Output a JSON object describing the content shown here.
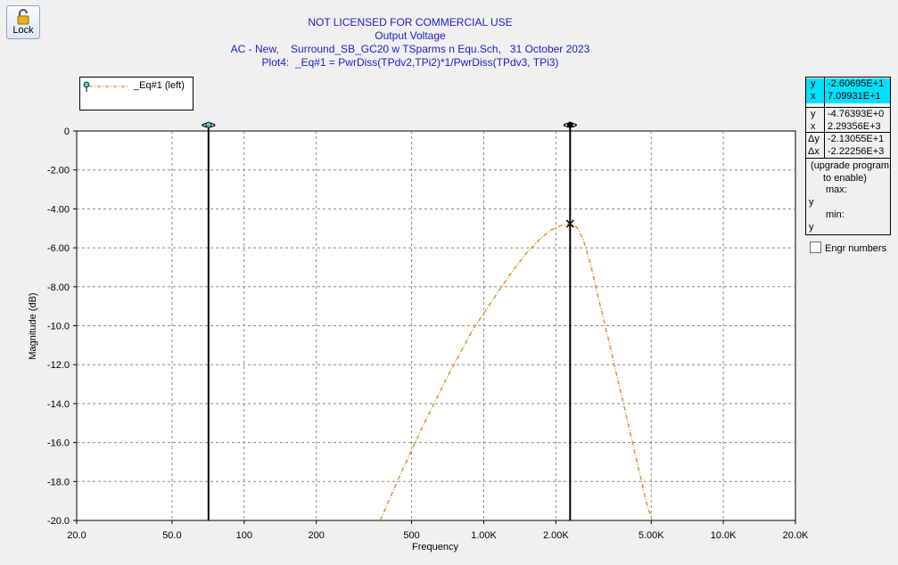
{
  "toolbar": {
    "lock_label": "Lock"
  },
  "header": {
    "license": "NOT LICENSED FOR COMMERCIAL USE",
    "title": "Output Voltage",
    "subtitle": "AC - New,    Surround_SB_GC20 w TSparms n Equ.Sch,   31 October 2023",
    "plot_label": "Plot4:  _Eq#1 = PwrDiss(TPdv2,TPi2)*1/PwrDiss(TPdv3, TPi3)"
  },
  "legend": {
    "label": "_Eq#1 (left)"
  },
  "readout": {
    "c1_y_key": "y",
    "c1_y": "-2.60695E+1",
    "c1_x_key": "x",
    "c1_x": "7.09931E+1",
    "c2_y_key": "y",
    "c2_y": "-4.76393E+0",
    "c2_x_key": "x",
    "c2_x": "2.29356E+3",
    "dy_key": "Δy",
    "dy": "-2.13055E+1",
    "dx_key": "Δx",
    "dx": "-2.22256E+3",
    "upgrade_line1": "(upgrade program",
    "upgrade_line2": "to enable)",
    "max_label": "max:",
    "min_label": "min:",
    "y_key_a": "y",
    "y_key_b": "y"
  },
  "engr_label": "Engr numbers",
  "chart_data": {
    "type": "line",
    "xlabel": "Frequency",
    "ylabel": "Magnitude  (dB)",
    "x_scale": "log",
    "xlim": [
      20,
      20000
    ],
    "ylim": [
      -20,
      0
    ],
    "grid": true,
    "legend_position": "top-left",
    "x_ticks": [
      20,
      50,
      100,
      200,
      500,
      1000,
      2000,
      5000,
      10000,
      20000
    ],
    "x_tick_labels": [
      "20.0",
      "50.0",
      "100",
      "200",
      "500",
      "1.00K",
      "2.00K",
      "5.00K",
      "10.0K",
      "20.0K"
    ],
    "y_ticks": [
      0,
      -2,
      -4,
      -6,
      -8,
      -10,
      -12,
      -14,
      -16,
      -18,
      -20
    ],
    "y_tick_labels": [
      "0",
      "-2.00",
      "-4.00",
      "-6.00",
      "-8.00",
      "-10.0",
      "-12.0",
      "-14.0",
      "-16.0",
      "-18.0",
      "-20.0"
    ],
    "series": [
      {
        "name": "_Eq#1 (left)",
        "color": "#e08a1e",
        "x": [
          370,
          450,
          550,
          700,
          900,
          1100,
          1300,
          1500,
          1700,
          1900,
          2100,
          2293.56,
          2450,
          2600,
          2800,
          3000,
          3300,
          3600,
          4000,
          4400,
          4800,
          5050
        ],
        "y": [
          -20.0,
          -17.6,
          -15.3,
          -12.7,
          -10.2,
          -8.6,
          -7.3,
          -6.3,
          -5.6,
          -5.1,
          -4.85,
          -4.76,
          -4.95,
          -5.55,
          -6.9,
          -8.5,
          -10.6,
          -12.6,
          -15.0,
          -17.2,
          -19.2,
          -20.0
        ]
      }
    ],
    "cursors": [
      {
        "x": 70.9931,
        "y": -26.0695
      },
      {
        "x": 2293.56,
        "y": -4.76393
      }
    ]
  }
}
